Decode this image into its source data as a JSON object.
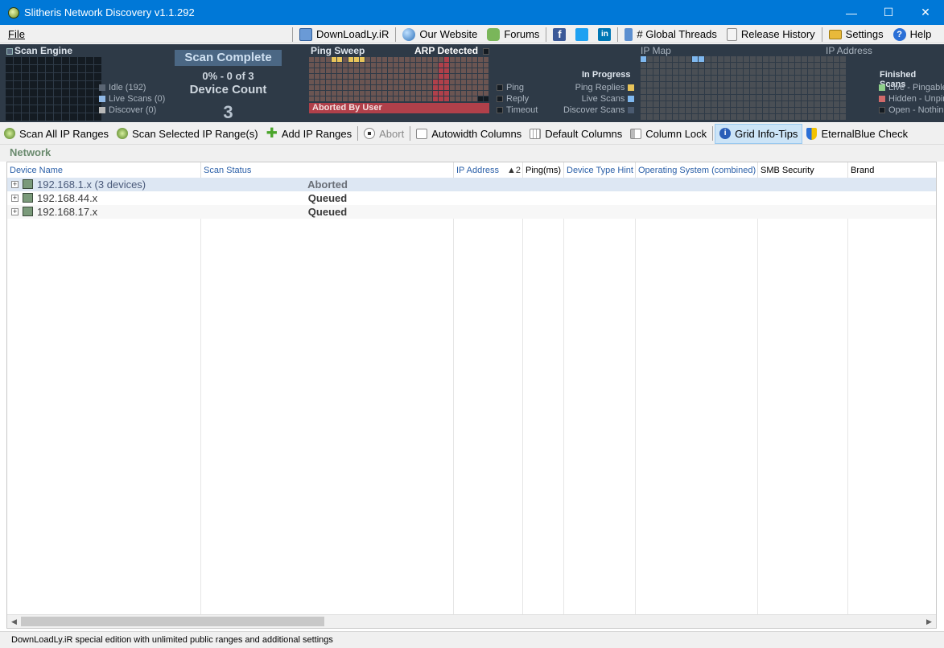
{
  "window": {
    "title": "Slitheris Network Discovery v1.1.292"
  },
  "menu": {
    "file": "File"
  },
  "top_links": [
    "DownLoadLy.iR",
    "Our Website",
    "Forums",
    "# Global Threads",
    "Release History",
    "Settings",
    "Help"
  ],
  "dashboard": {
    "scan_engine": {
      "title": "Scan Engine",
      "legend": [
        "Idle (192)",
        "Live Scans (0)",
        "Discover (0)"
      ]
    },
    "status": {
      "scan_complete": "Scan Complete",
      "progress": "0% - 0 of 3",
      "device_count_label": "Device Count",
      "device_count": "3"
    },
    "ping_sweep": {
      "title": "Ping Sweep",
      "arp": "ARP Detected",
      "aborted": "Aborted By User",
      "legend": [
        "Ping",
        "Reply",
        "Timeout"
      ]
    },
    "in_progress": {
      "title": "In Progress",
      "items": [
        "Ping Replies",
        "Live Scans",
        "Discover Scans"
      ]
    },
    "ip_map": {
      "title": "IP Map",
      "address_label": "IP Address"
    },
    "finished": {
      "title": "Finished Scans",
      "items": [
        "Live - Pingable",
        "Hidden - Unpingable",
        "Open - Nothing"
      ]
    },
    "colors": {
      "panel_bg": "#2e3a47",
      "cell": "#141b22",
      "ping_cell": "#6b5552",
      "ping_fill": "#b0404a",
      "yellow": "#e8c45a",
      "blue": "#7fb8ef",
      "green": "#8fd08a",
      "red": "#d06a6a"
    }
  },
  "toolbar": {
    "scan_all": "Scan All IP Ranges",
    "scan_selected": "Scan Selected IP Range(s)",
    "add_ranges": "Add IP Ranges",
    "abort": "Abort",
    "autowidth": "Autowidth Columns",
    "default_columns": "Default Columns",
    "column_lock": "Column Lock",
    "grid_tips": "Grid Info-Tips",
    "eternalblue": "EternalBlue Check"
  },
  "network_label": "Network",
  "columns": [
    "Device Name",
    "Scan Status",
    "IP Address",
    "Ping(ms)",
    "Device Type Hint",
    "Operating System (combined)",
    "SMB Security",
    "Brand"
  ],
  "sort": {
    "column": "IP Address",
    "indicator": "▲2"
  },
  "rows": [
    {
      "name": "192.168.1.x (3 devices)",
      "status": "Aborted"
    },
    {
      "name": "192.168.44.x",
      "status": "Queued"
    },
    {
      "name": "192.168.17.x",
      "status": "Queued"
    }
  ],
  "statusbar": "DownLoadLy.iR special edition with unlimited public ranges and additional settings"
}
